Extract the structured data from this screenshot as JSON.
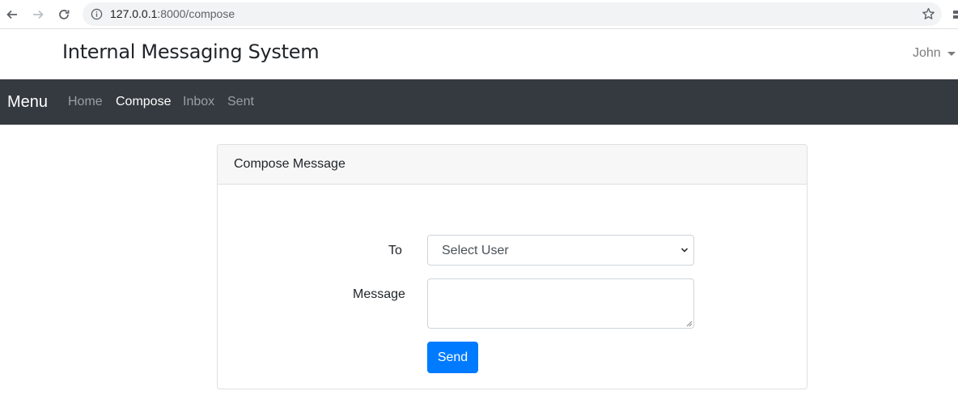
{
  "browser": {
    "url_host": "127.0.0.1",
    "url_port_path": ":8000/compose"
  },
  "header": {
    "title": "Internal Messaging System",
    "user_name": "John"
  },
  "navbar": {
    "brand": "Menu",
    "items": [
      {
        "label": "Home",
        "active": false
      },
      {
        "label": "Compose",
        "active": true
      },
      {
        "label": "Inbox",
        "active": false
      },
      {
        "label": "Sent",
        "active": false
      }
    ]
  },
  "compose_card": {
    "title": "Compose Message",
    "to_label": "To",
    "to_selected": "Select User",
    "message_label": "Message",
    "message_value": "",
    "send_label": "Send"
  },
  "colors": {
    "navbar_bg": "#343a40",
    "primary": "#007bff",
    "card_header_bg": "#f7f7f7"
  }
}
